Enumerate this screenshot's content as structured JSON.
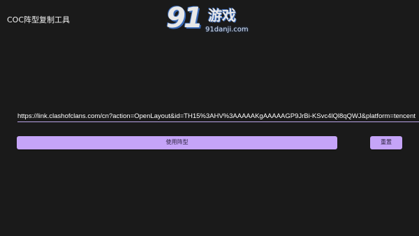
{
  "app": {
    "title": "COC阵型复制工具"
  },
  "watermark": {
    "number": "91",
    "name": "游戏",
    "domain": "91danji.com"
  },
  "layout_input": {
    "value": "https://link.clashofclans.com/cn?action=OpenLayout&id=TH15%3AHV%3AAAAAKgAAAAAGP9JrBi-KSvc4lQl8qQWJ&platform=tencent"
  },
  "actions": {
    "apply_label": "使用阵型",
    "reset_label": "重置"
  },
  "colors": {
    "background": "#1a1a1a",
    "button": "#c5a4f8",
    "input_underline": "#b9a3e6"
  }
}
